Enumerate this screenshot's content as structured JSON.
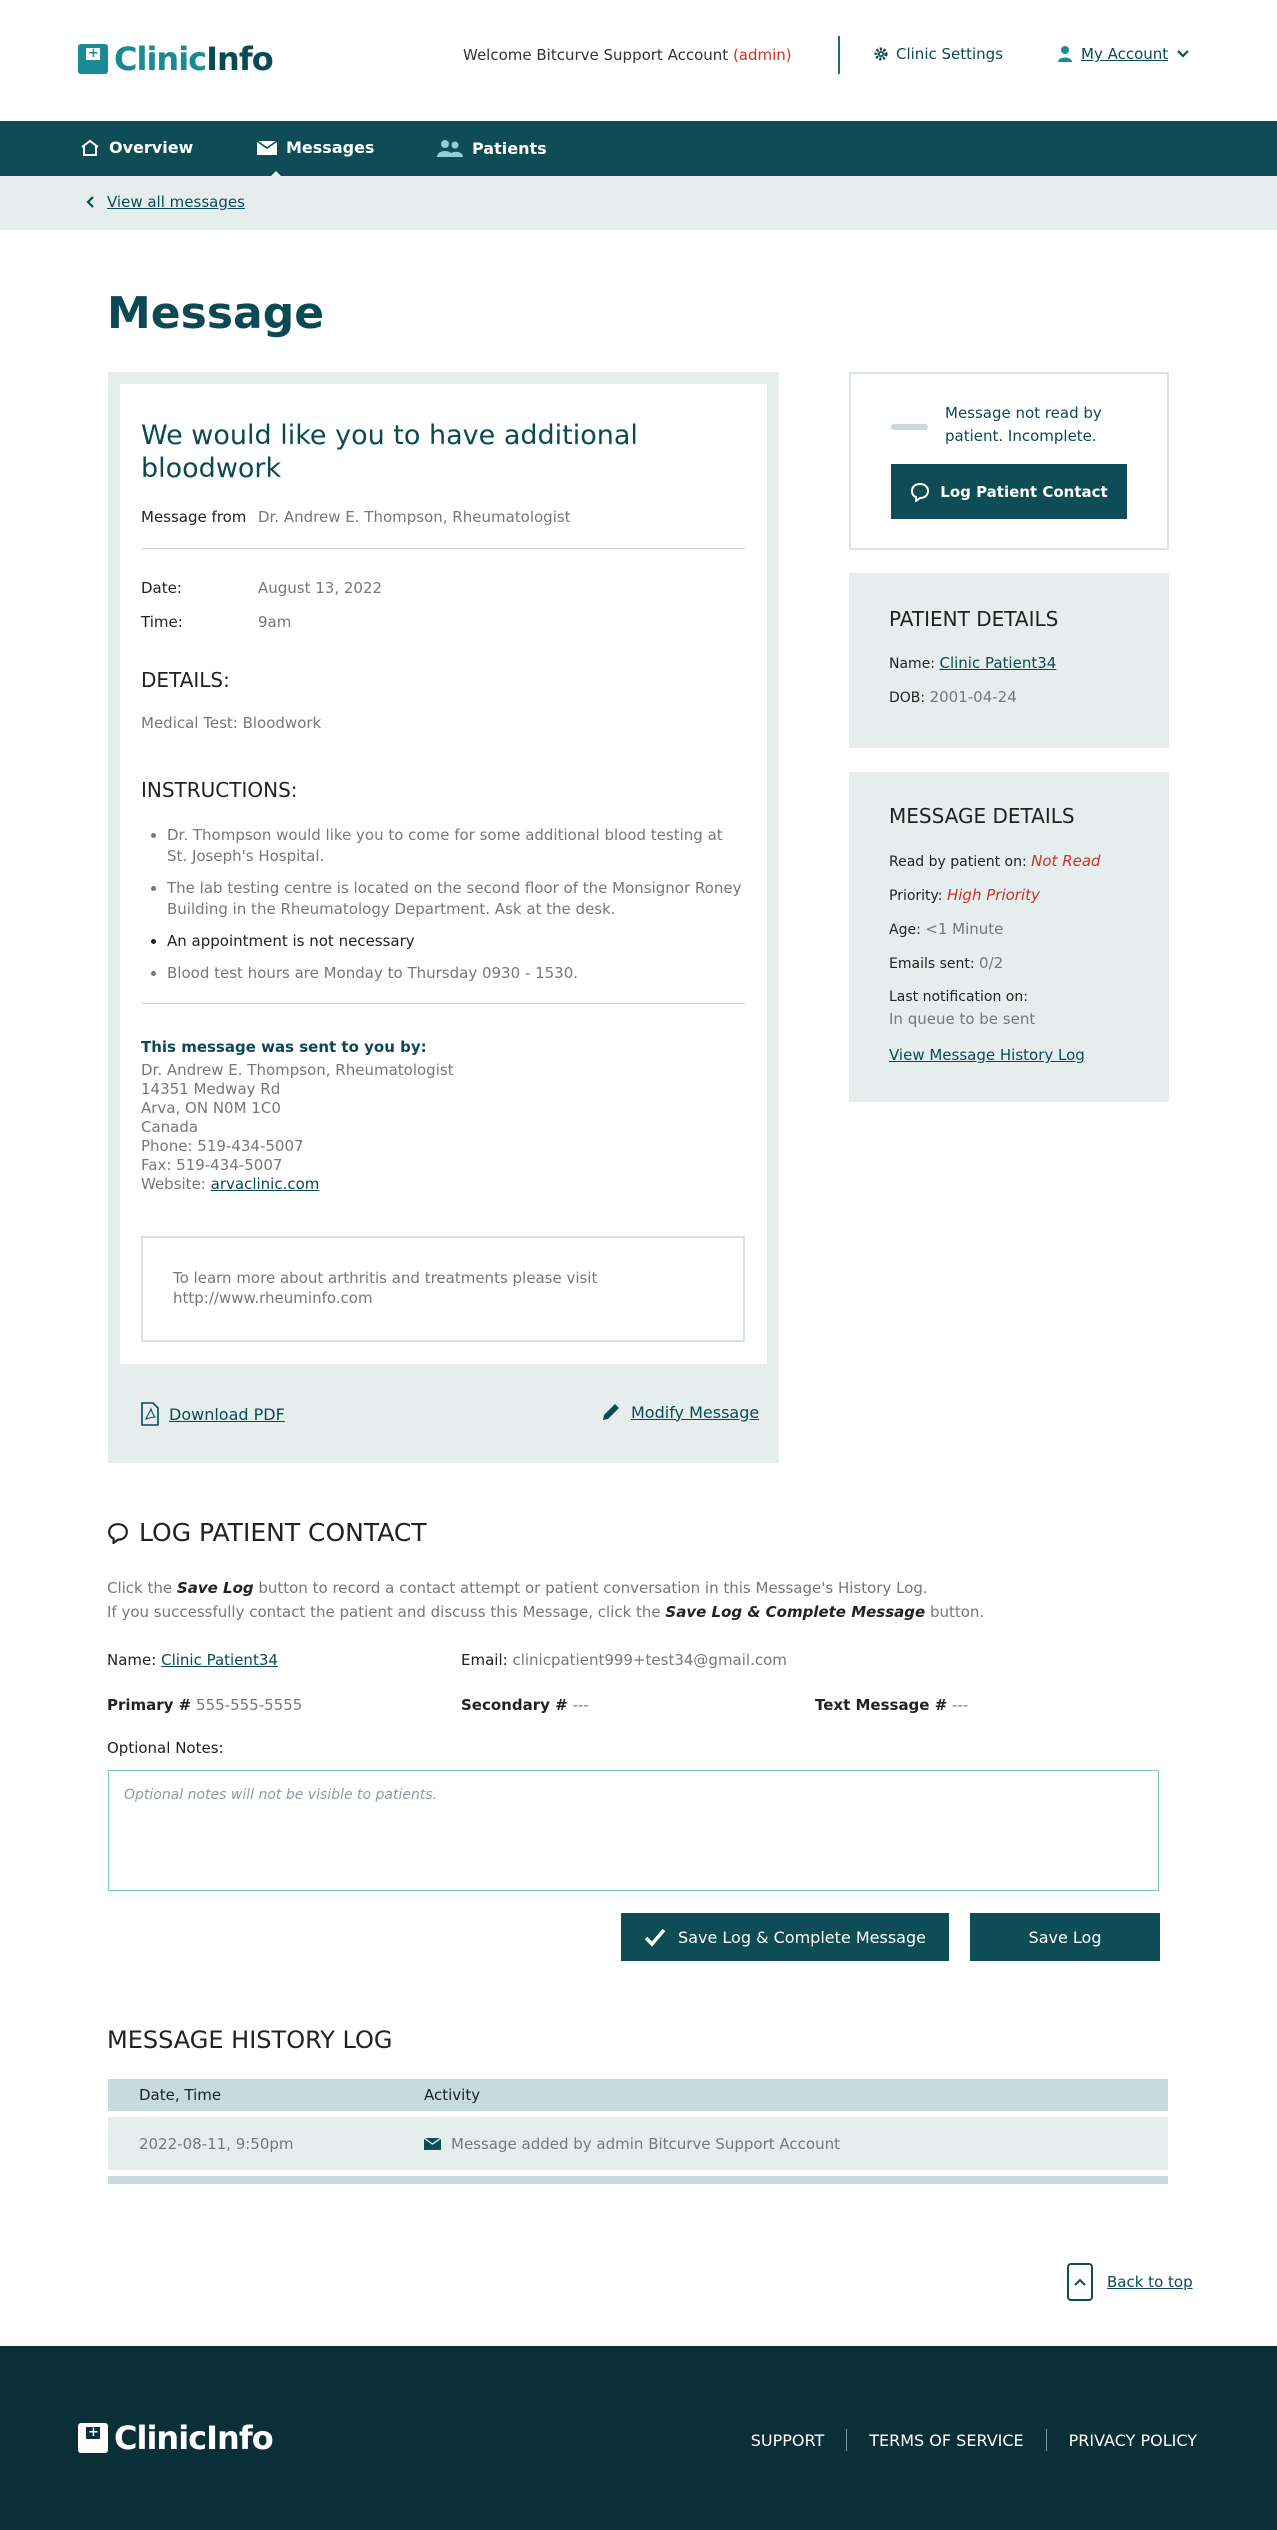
{
  "header": {
    "logo_a": "Clinic",
    "logo_b": "Info",
    "welcome_prefix": "Welcome Bitcurve Support Account",
    "welcome_role": "(admin)",
    "clinic_settings": "Clinic Settings",
    "my_account": "My Account"
  },
  "nav": {
    "items": [
      {
        "label": "Overview",
        "icon": "home-icon"
      },
      {
        "label": "Messages",
        "icon": "envelope-icon"
      },
      {
        "label": "Patients",
        "icon": "users-icon"
      }
    ],
    "active": "Messages",
    "back_link": "View all messages"
  },
  "page": {
    "title": "Message"
  },
  "message": {
    "title": "We would like you to have additional bloodwork",
    "from_label": "Message from",
    "from_value": "Dr. Andrew E. Thompson, Rheumatologist",
    "date_label": "Date:",
    "date_value": "August 13, 2022",
    "time_label": "Time:",
    "time_value": "9am",
    "details_heading": "DETAILS:",
    "details_text": "Medical Test: Bloodwork",
    "instructions_heading": "INSTRUCTIONS:",
    "instructions": [
      "Dr. Thompson would like you to come for some additional blood testing at St. Joseph's Hospital.",
      "The lab testing centre is located on the second floor of the Monsignor Roney Building in the Rheumatology Department. Ask at the desk.",
      "An appointment is not necessary",
      "Blood test hours are Monday to Thursday 0930 - 1530."
    ],
    "sent_by_heading": "This message was sent to you by:",
    "sender_lines": [
      "Dr. Andrew E. Thompson, Rheumatologist",
      "14351 Medway Rd",
      "Arva, ON N0M 1C0",
      "Canada",
      "Phone: 519-434-5007",
      "Fax: 519-434-5007"
    ],
    "website_label": "Website:",
    "website_link": "arvaclinic.com",
    "notice": "To learn more about arthritis and treatments please visit http://www.rheuminfo.com",
    "download_pdf": "Download PDF",
    "modify_message": "Modify Message"
  },
  "status": {
    "text": "Message not read by patient. Incomplete.",
    "log_button": "Log Patient Contact"
  },
  "patient_details": {
    "heading": "PATIENT DETAILS",
    "name_label": "Name:",
    "name_value": "Clinic Patient34",
    "dob_label": "DOB:",
    "dob_value": "2001-04-24"
  },
  "message_details": {
    "heading": "MESSAGE DETAILS",
    "read_label": "Read by patient on:",
    "read_value": "Not Read",
    "priority_label": "Priority:",
    "priority_value": "High Priority",
    "age_label": "Age:",
    "age_value": "<1 Minute",
    "emails_label": "Emails sent:",
    "emails_value": "0/2",
    "last_notif_label": "Last notification on:",
    "last_notif_value": "In queue to be sent",
    "history_link": "View Message History Log"
  },
  "log_contact": {
    "heading": "LOG PATIENT CONTACT",
    "desc1_a": "Click the ",
    "desc1_b": "Save Log",
    "desc1_c": " button to record a contact attempt or patient conversation in this Message's History Log.",
    "desc2_a": "If you successfully contact the patient and discuss this Message, click the ",
    "desc2_b": "Save Log & Complete Message",
    "desc2_c": " button.",
    "name_label": "Name:",
    "name_value": "Clinic Patient34",
    "email_label": "Email:",
    "email_value": "clinicpatient999+test34@gmail.com",
    "primary_label": "Primary #",
    "primary_value": "555-555-5555",
    "secondary_label": "Secondary #",
    "secondary_value": "---",
    "text_label": "Text Message #",
    "text_value": "---",
    "notes_label": "Optional Notes:",
    "notes_placeholder": "Optional notes will not be visible to patients.",
    "complete_button": "Save Log & Complete Message",
    "save_button": "Save Log"
  },
  "history": {
    "heading": "MESSAGE HISTORY LOG",
    "col_date": "Date, Time",
    "col_activity": "Activity",
    "rows": [
      {
        "date": "2022-08-11, 9:50pm",
        "activity": "Message added by admin Bitcurve Support Account"
      }
    ]
  },
  "back_to_top": "Back to top",
  "footer": {
    "logo": "ClinicInfo",
    "links": [
      "SUPPORT",
      "TERMS OF SERVICE",
      "PRIVACY POLICY"
    ]
  },
  "colors": {
    "primary": "#0e4d56",
    "accent": "#1a8a93",
    "alert": "#d0302a",
    "panel": "#e5eeed"
  }
}
